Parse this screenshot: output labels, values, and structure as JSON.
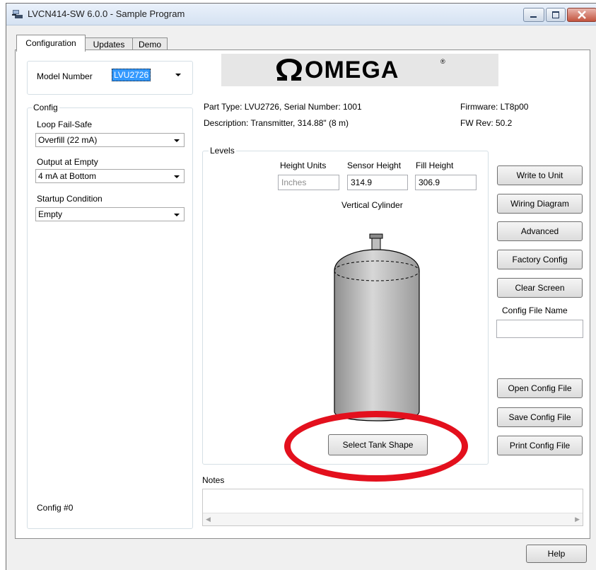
{
  "window": {
    "title": "LVCN414-SW 6.0.0 - Sample Program"
  },
  "tabs": [
    {
      "label": "Configuration",
      "active": true
    },
    {
      "label": "Updates",
      "active": false
    },
    {
      "label": "Demo",
      "active": false
    }
  ],
  "model": {
    "label": "Model Number",
    "value": "LVU2726"
  },
  "config": {
    "legend": "Config",
    "loop_fail_safe_label": "Loop Fail-Safe",
    "loop_fail_safe_value": "Overfill (22 mA)",
    "output_at_empty_label": "Output at Empty",
    "output_at_empty_value": "4 mA at Bottom",
    "startup_condition_label": "Startup Condition",
    "startup_condition_value": "Empty",
    "config_number": "Config #0"
  },
  "logo": {
    "text": "OMEGA",
    "mark": "®"
  },
  "info": {
    "part_type": "Part Type: LVU2726, Serial Number: 1001",
    "description": "Description: Transmitter, 314.88\" (8 m)",
    "firmware": "Firmware: LT8p00",
    "fw_rev": "FW Rev:  50.2"
  },
  "levels": {
    "legend": "Levels",
    "height_units_label": "Height Units",
    "height_units_value": "Inches",
    "sensor_height_label": "Sensor Height",
    "sensor_height_value": "314.9",
    "fill_height_label": "Fill Height",
    "fill_height_value": "306.9",
    "tank_shape_name": "Vertical Cylinder",
    "select_tank_shape": "Select Tank Shape"
  },
  "buttons": {
    "write_to_unit": "Write to Unit",
    "wiring_diagram": "Wiring Diagram",
    "advanced": "Advanced",
    "factory_config": "Factory Config",
    "clear_screen": "Clear Screen",
    "config_file_name_label": "Config File Name",
    "config_file_name_value": "",
    "open_config_file": "Open Config File",
    "save_config_file": "Save Config File",
    "print_config_file": "Print Config File",
    "help": "Help"
  },
  "notes": {
    "label": "Notes",
    "value": ""
  },
  "colors": {
    "highlight": "#e3101d",
    "selection": "#3399ff"
  }
}
